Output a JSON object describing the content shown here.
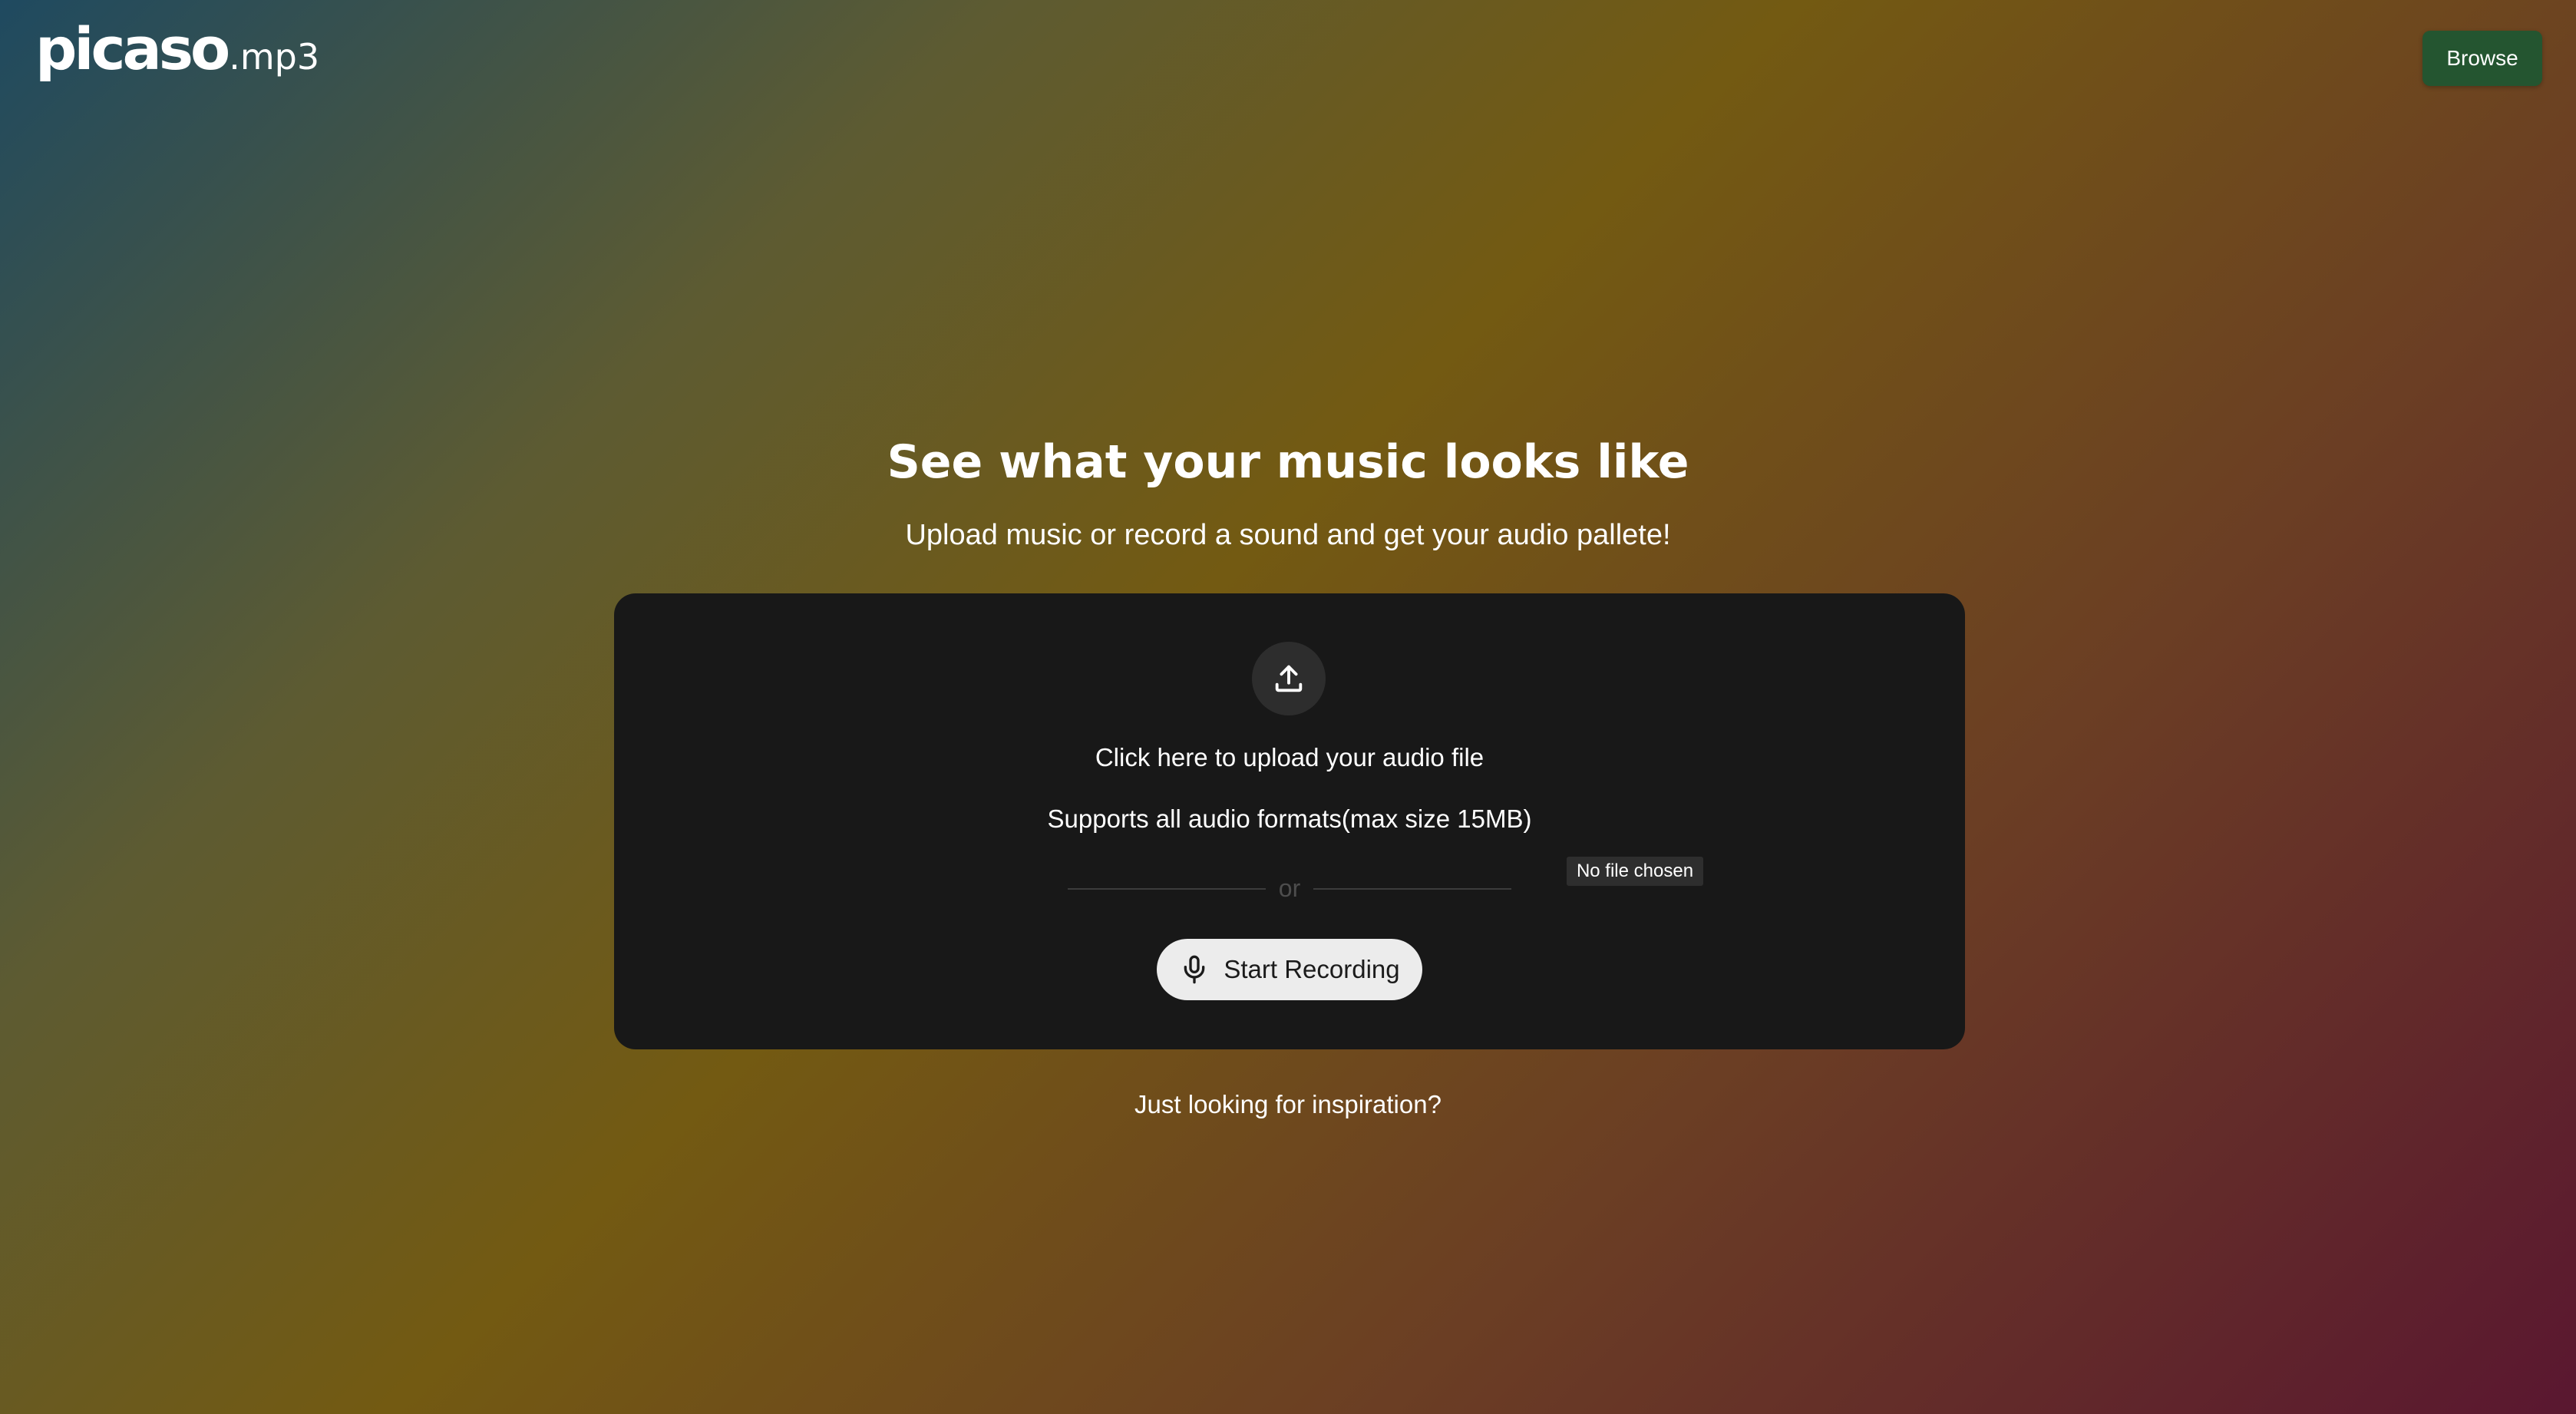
{
  "header": {
    "logo_main": "picaso",
    "logo_sub": ".mp3",
    "browse_label": "Browse"
  },
  "hero": {
    "title": "See what your music looks like",
    "subtitle": "Upload music or record a sound and get your audio pallete!"
  },
  "upload": {
    "icon": "upload-icon",
    "prompt": "Click here to upload your audio file",
    "support": "Supports all audio formats(max size 15MB)",
    "divider_text": "or",
    "file_status": "No file chosen",
    "record_icon": "microphone-icon",
    "record_label": "Start Recording"
  },
  "footer": {
    "inspiration_link": "Just looking for inspiration?"
  },
  "colors": {
    "card_background": "#181818",
    "browse_button": "#245530",
    "record_button": "#ececec"
  }
}
